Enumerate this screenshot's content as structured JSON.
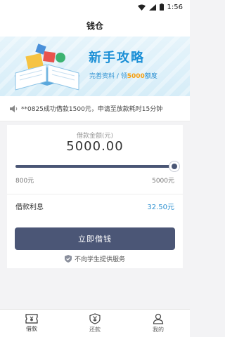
{
  "status_bar": {
    "time": "1:56"
  },
  "header": {
    "title": "钱仓"
  },
  "banner": {
    "headline": "新手攻略",
    "subline_prefix": "完善资料 / 领",
    "subline_amount": "5000",
    "subline_suffix": "额度",
    "colors": {
      "headline": "#1b8fd6",
      "amount": "#f5a012"
    }
  },
  "notice": {
    "icon": "speaker-icon",
    "text": "**0825成功借款1500元，申请至放款耗时15分钟"
  },
  "loan": {
    "amount_label": "借款金额(元)",
    "amount_value": "5000.00",
    "slider": {
      "min_label": "800元",
      "max_label": "5000元",
      "fraction": 1.0
    },
    "interest_label": "借款利息",
    "interest_value": "32.50元",
    "borrow_button": "立即借钱",
    "promise_text": "不向学生提供服务",
    "colors": {
      "button": "#4b5676",
      "interest": "#2a8fd0"
    }
  },
  "tabs": [
    {
      "label": "借款",
      "icon": "ticket-icon",
      "active": true
    },
    {
      "label": "还款",
      "icon": "yen-shield-icon",
      "active": false
    },
    {
      "label": "我的",
      "icon": "person-icon",
      "active": false
    }
  ]
}
